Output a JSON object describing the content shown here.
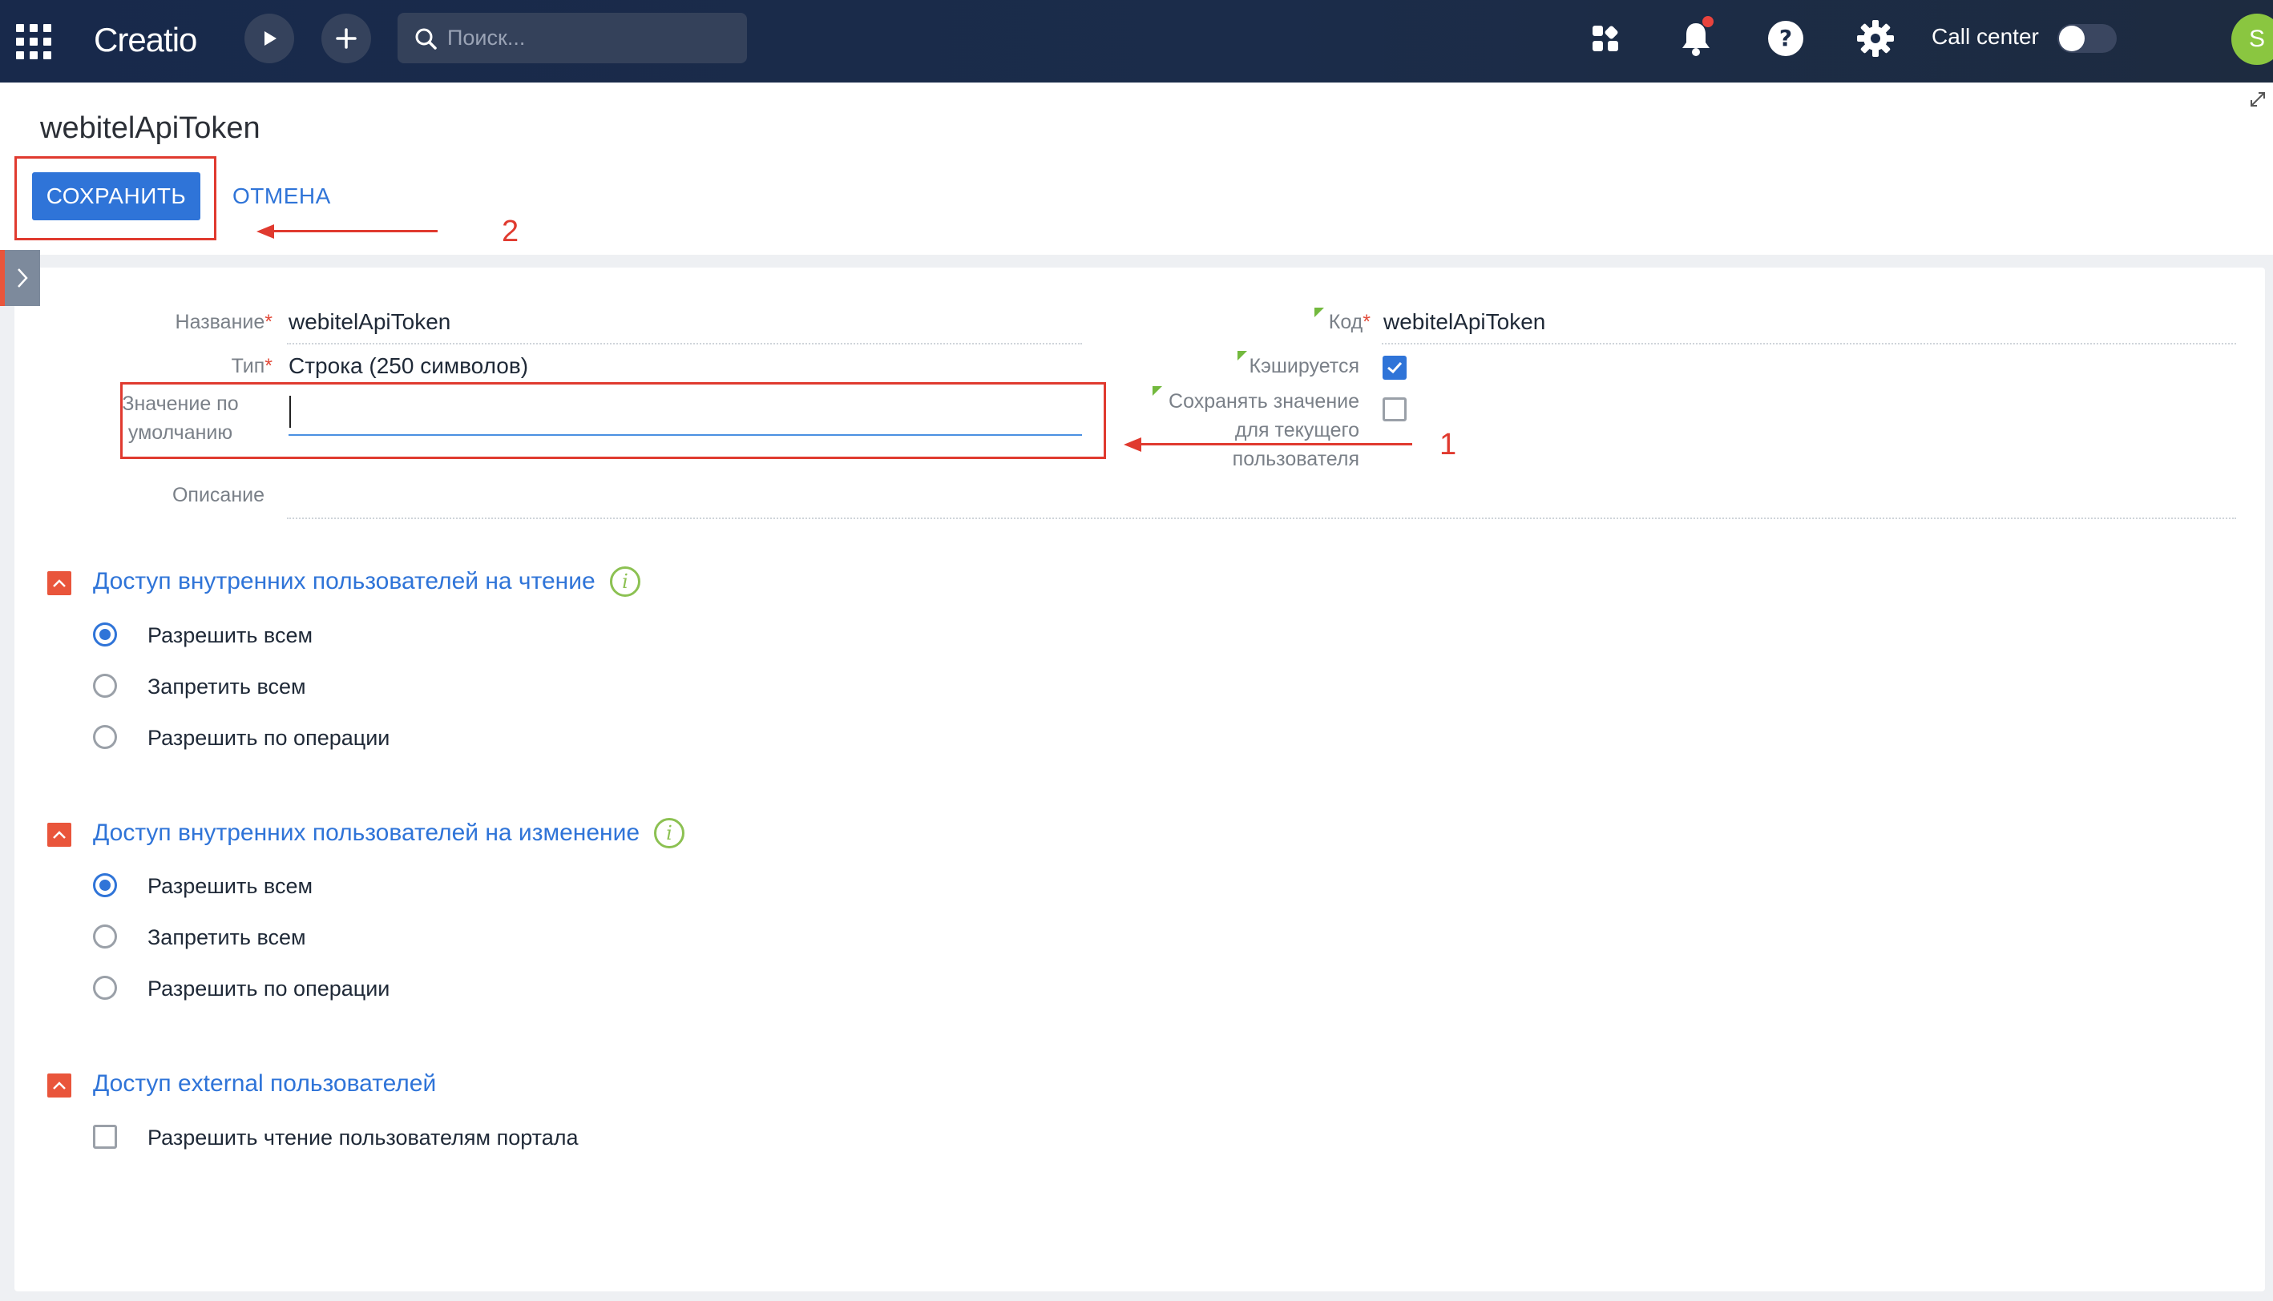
{
  "topbar": {
    "logo": "Creatio",
    "search_placeholder": "Поиск...",
    "call_center_label": "Call center",
    "avatar_initial": "S",
    "icons": [
      "apps-grid-icon",
      "play-icon",
      "plus-icon",
      "search-icon",
      "apps-icon",
      "bell-icon",
      "help-icon",
      "gear-icon"
    ]
  },
  "page": {
    "title": "webitelApiToken",
    "save_label": "СОХРАНИТЬ",
    "cancel_label": "ОТМЕНА"
  },
  "form": {
    "name_label": "Название",
    "name_value": "webitelApiToken",
    "type_label": "Тип",
    "type_value": "Строка (250 символов)",
    "default_label_line1": "Значение по",
    "default_label_line2": "умолчанию",
    "default_value": "",
    "description_label": "Описание",
    "code_label": "Код",
    "code_value": "webitelApiToken",
    "cached_label": "Кэшируется",
    "cached_checked": true,
    "save_for_user_line1": "Сохранять значение",
    "save_for_user_line2": "для текущего",
    "save_for_user_line3": "пользователя",
    "save_for_user_checked": false
  },
  "sections": [
    {
      "title": "Доступ внутренних пользователей на чтение",
      "options": [
        "Разрешить всем",
        "Запретить всем",
        "Разрешить по операции"
      ],
      "selected": 0
    },
    {
      "title": "Доступ внутренних пользователей на изменение",
      "options": [
        "Разрешить всем",
        "Запретить всем",
        "Разрешить по операции"
      ],
      "selected": 0
    },
    {
      "title": "Доступ external пользователей",
      "checkbox_label": "Разрешить чтение пользователям портала",
      "checked": false
    }
  ],
  "annotations": {
    "marker_1": "1",
    "marker_2": "2",
    "color": "#e03a2f"
  },
  "colors": {
    "accent": "#2f74d8",
    "topbar": "#18294b",
    "section_toggle": "#e9553b",
    "info": "#8cc152",
    "avatar": "#8ac640"
  }
}
